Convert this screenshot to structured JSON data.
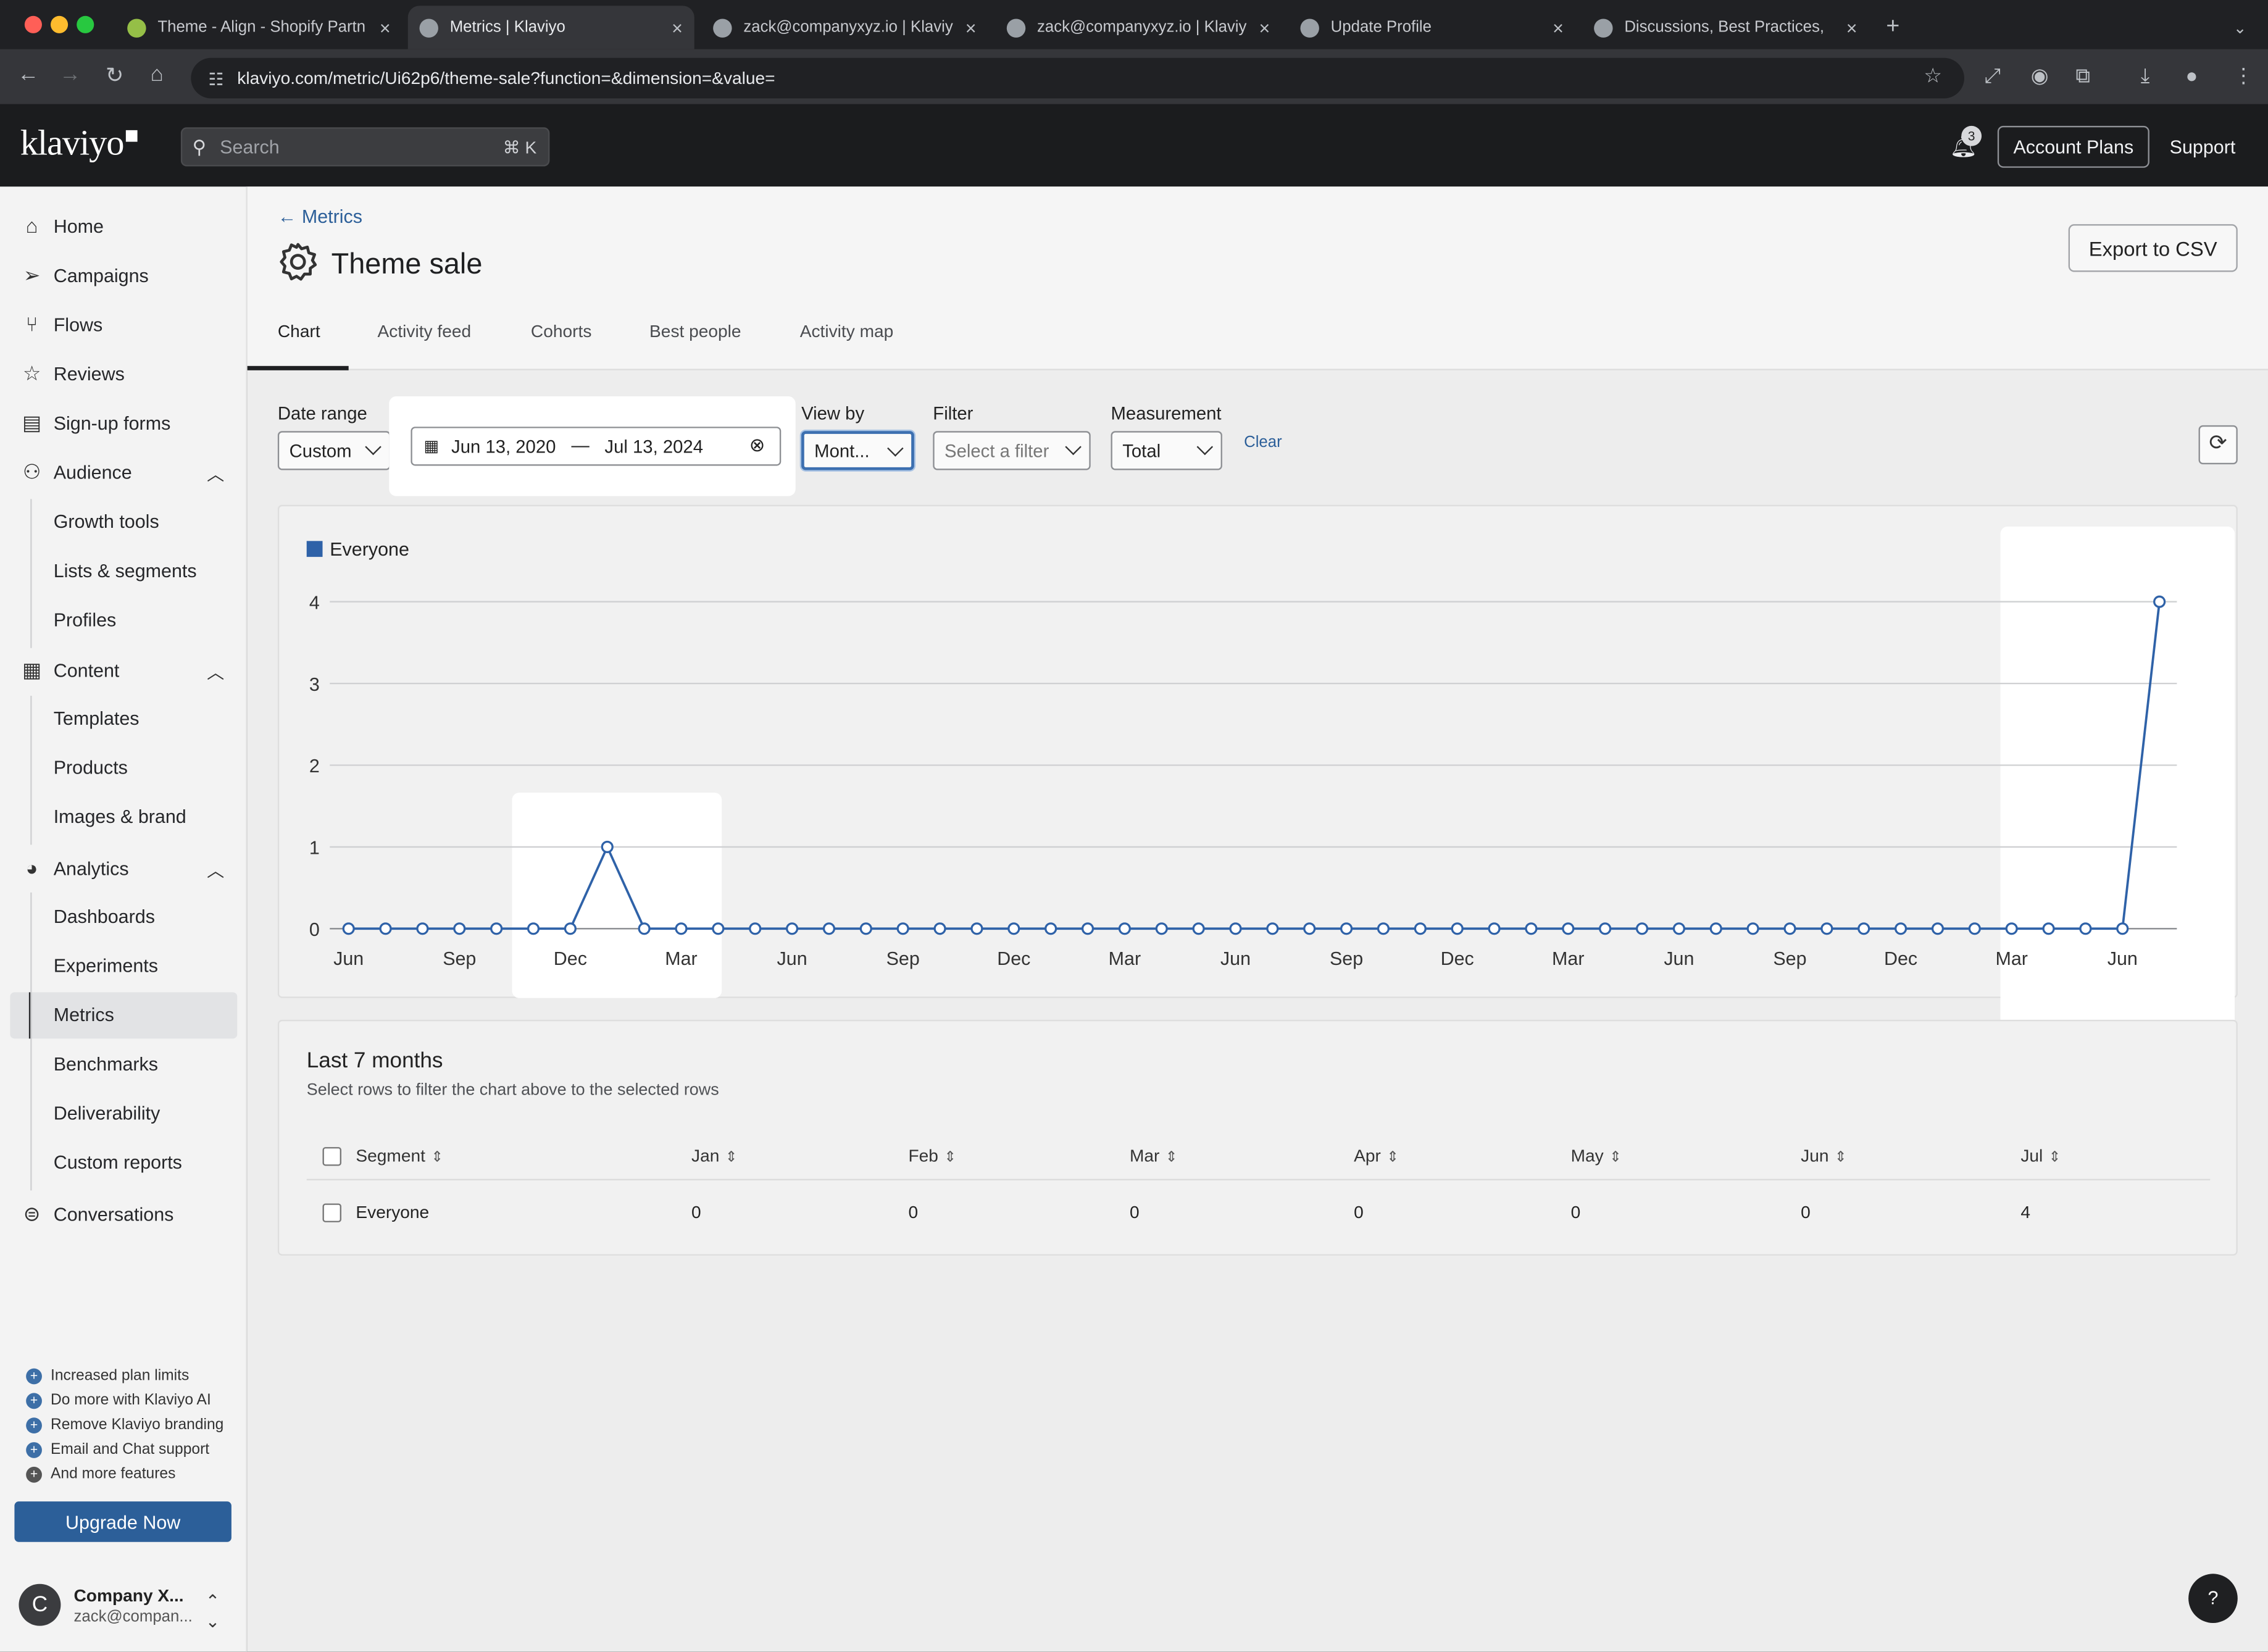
{
  "browser": {
    "tabs": [
      {
        "title": "Theme - Align - Shopify Partn",
        "active": false
      },
      {
        "title": "Metrics | Klaviyo",
        "active": true
      },
      {
        "title": "zack@companyxyz.io | Klaviyo",
        "active": false
      },
      {
        "title": "zack@companyxyz.io | Klaviyo",
        "active": false
      },
      {
        "title": "Update Profile",
        "active": false
      },
      {
        "title": "Discussions, Best Practices,",
        "active": false
      }
    ],
    "url": "klaviyo.com/metric/Ui62p6/theme-sale?function=&dimension=&value="
  },
  "header": {
    "logo": "klaviyo",
    "search_placeholder": "Search",
    "search_shortcut": "⌘ K",
    "notification_count": "3",
    "account_plans": "Account Plans",
    "support": "Support"
  },
  "sidebar": {
    "items": [
      {
        "label": "Home",
        "icon": "home-icon"
      },
      {
        "label": "Campaigns",
        "icon": "send-icon"
      },
      {
        "label": "Flows",
        "icon": "flow-icon"
      },
      {
        "label": "Reviews",
        "icon": "star-icon"
      },
      {
        "label": "Sign-up forms",
        "icon": "form-icon"
      },
      {
        "label": "Audience",
        "icon": "people-icon"
      },
      {
        "label": "Growth tools"
      },
      {
        "label": "Lists & segments"
      },
      {
        "label": "Profiles"
      },
      {
        "label": "Content",
        "icon": "content-icon"
      },
      {
        "label": "Templates"
      },
      {
        "label": "Products"
      },
      {
        "label": "Images & brand"
      },
      {
        "label": "Analytics",
        "icon": "pie-chart-icon"
      },
      {
        "label": "Dashboards"
      },
      {
        "label": "Experiments"
      },
      {
        "label": "Metrics",
        "selected": true
      },
      {
        "label": "Benchmarks"
      },
      {
        "label": "Deliverability"
      },
      {
        "label": "Custom reports"
      },
      {
        "label": "Conversations",
        "icon": "chat-icon"
      }
    ],
    "promo": [
      "Increased plan limits",
      "Do more with Klaviyo AI",
      "Remove Klaviyo branding",
      "Email and Chat support",
      "And more features"
    ],
    "upgrade": "Upgrade Now",
    "account": {
      "initial": "C",
      "name": "Company X...",
      "email": "zack@compan..."
    }
  },
  "page": {
    "breadcrumb": "Metrics",
    "title": "Theme sale",
    "export": "Export to CSV",
    "tabs": [
      "Chart",
      "Activity feed",
      "Cohorts",
      "Best people",
      "Activity map"
    ],
    "active_tab": "Chart"
  },
  "filters": {
    "date_range_label": "Date range",
    "date_range_value": "Custom",
    "start_date": "Jun 13, 2020",
    "end_date": "Jul 13, 2024",
    "date_separator": "—",
    "view_by_label": "View by",
    "view_by_value": "Mont...",
    "filter_label": "Filter",
    "filter_placeholder": "Select a filter",
    "measurement_label": "Measurement",
    "measurement_value": "Total",
    "clear": "Clear"
  },
  "chart_data": {
    "type": "line",
    "title": "",
    "xlabel": "",
    "ylabel": "",
    "ylim": [
      0,
      4
    ],
    "yticks": [
      0,
      1,
      2,
      3,
      4
    ],
    "grid": true,
    "legend_position": "top-left",
    "x_tick_labels": [
      "Jun",
      "Sep",
      "Dec",
      "Mar",
      "Jun",
      "Sep",
      "Dec",
      "Mar",
      "Jun",
      "Sep",
      "Dec",
      "Mar",
      "Jun",
      "Sep",
      "Dec",
      "Mar",
      "Jun"
    ],
    "series": [
      {
        "name": "Everyone",
        "color": "#2f62a8",
        "values": [
          0,
          0,
          0,
          0,
          0,
          0,
          0,
          1,
          0,
          0,
          0,
          0,
          0,
          0,
          0,
          0,
          0,
          0,
          0,
          0,
          0,
          0,
          0,
          0,
          0,
          0,
          0,
          0,
          0,
          0,
          0,
          0,
          0,
          0,
          0,
          0,
          0,
          0,
          0,
          0,
          0,
          0,
          0,
          0,
          0,
          0,
          0,
          0,
          0,
          4
        ]
      }
    ]
  },
  "table": {
    "title": "Last 7 months",
    "subtitle": "Select rows to filter the chart above to the selected rows",
    "columns": [
      "Segment",
      "Jan",
      "Feb",
      "Mar",
      "Apr",
      "May",
      "Jun",
      "Jul"
    ],
    "rows": [
      {
        "segment": "Everyone",
        "values": [
          "0",
          "0",
          "0",
          "0",
          "0",
          "0",
          "4"
        ]
      }
    ]
  },
  "help": "?"
}
